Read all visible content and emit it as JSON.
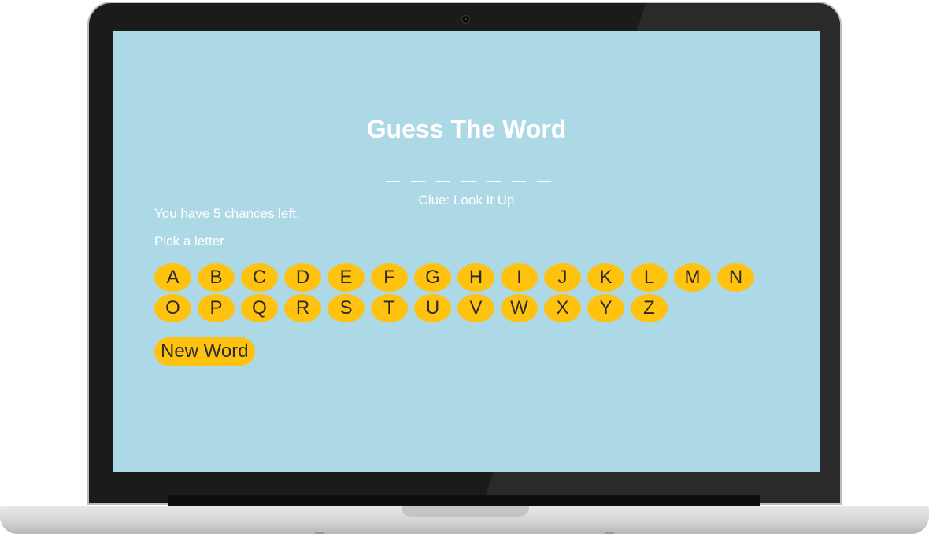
{
  "game": {
    "title": "Guess The Word",
    "word_blank_count": 7,
    "clue": "Clue: Look It Up",
    "chances_text": "You have 5 chances left.",
    "pick_prompt": "Pick a letter",
    "letters": [
      "A",
      "B",
      "C",
      "D",
      "E",
      "F",
      "G",
      "H",
      "I",
      "J",
      "K",
      "L",
      "M",
      "N",
      "O",
      "P",
      "Q",
      "R",
      "S",
      "T",
      "U",
      "V",
      "W",
      "X",
      "Y",
      "Z"
    ],
    "new_word_label": "New Word"
  },
  "colors": {
    "screen_background": "#add8e6",
    "button_accent": "#ffc20e",
    "text_on_screen": "#ffffff"
  },
  "icons": [
    "camera-icon"
  ]
}
